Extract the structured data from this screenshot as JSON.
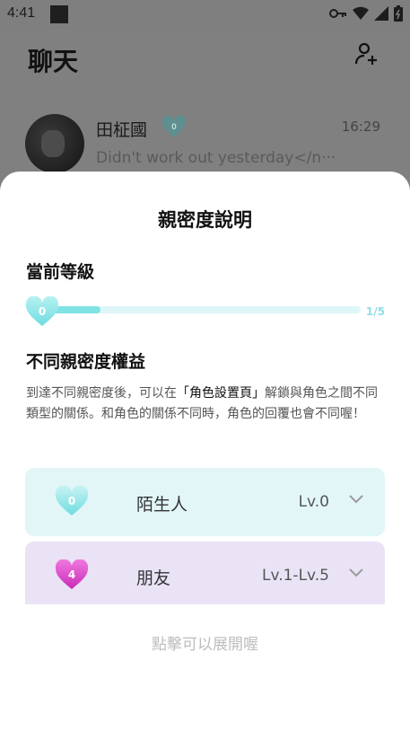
{
  "status_bar": {
    "time": "4:41",
    "icons": [
      "key-icon",
      "wifi-icon",
      "signal-icon",
      "battery-icon"
    ]
  },
  "chat_page": {
    "title": "聊天",
    "add_friend_icon": "person-add-icon",
    "chat": {
      "name": "田柾國",
      "heart_level": "0",
      "time": "16:29",
      "preview": "Didn't work out yesterday</n···"
    }
  },
  "sheet": {
    "title": "親密度說明",
    "current_level": {
      "heading": "當前等級",
      "heart_value": "0",
      "progress_label": "1/5",
      "progress_fraction": 0.2
    },
    "benefits": {
      "heading": "不同親密度權益",
      "desc_before": "到達不同親密度後，可以在",
      "desc_highlight": "「角色設置頁」",
      "desc_after": "解鎖與角色之間不同類型的關係。和角色的關係不同時，角色的回覆也會不同喔！"
    },
    "levels": [
      {
        "heart": "0",
        "name": "陌生人",
        "lv": "Lv.0",
        "color": "#8fe3e6"
      },
      {
        "heart": "4",
        "name": "朋友",
        "lv": "Lv.1-Lv.5",
        "color": "#e040c8"
      }
    ],
    "tap_more": "點擊可以展開喔"
  },
  "colors": {
    "accent_teal": "#7fe3e4",
    "accent_pink": "#e040c8",
    "card_teal_bg": "#e2f6f8",
    "card_purple_bg": "#eae3f6"
  }
}
